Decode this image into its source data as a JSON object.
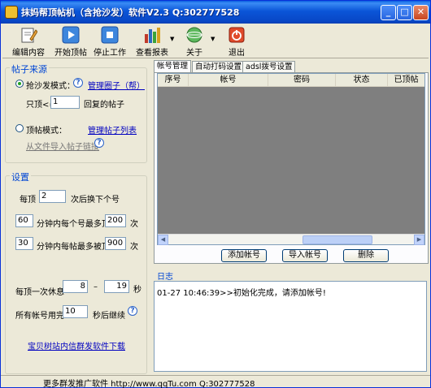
{
  "window": {
    "title": "抹妈帮顶帖机（含抢沙发）软件V2.3 Q:302777528",
    "minimize_label": "_",
    "maximize_label": "□",
    "close_label": "✕"
  },
  "toolbar": {
    "items": [
      {
        "label": "编辑内容",
        "icon": "edit-icon"
      },
      {
        "label": "开始顶帖",
        "icon": "play-icon"
      },
      {
        "label": "停止工作",
        "icon": "stop-icon"
      },
      {
        "label": "查看报表",
        "icon": "report-icon"
      },
      {
        "label": "关于",
        "icon": "about-icon"
      },
      {
        "label": "退出",
        "icon": "exit-icon"
      }
    ]
  },
  "source": {
    "title": "帖子来源",
    "grab_mode_label": "抢沙发模式：",
    "grab_mode_checked": true,
    "manage_circles_link": "管理圈子（帮）",
    "only_top_label": "只顶<=",
    "only_top_value": "1",
    "only_top_suffix": "回复的帖子",
    "top_mode_label": "顶帖模式：",
    "top_mode_checked": false,
    "manage_posts_link": "管理帖子列表",
    "import_link": "从文件导入帖子链接"
  },
  "settings": {
    "title": "设置",
    "every_label": "每顶",
    "every_value": "2",
    "every_suffix": "次后换下个号",
    "minutes1_value": "60",
    "per_account_label": "分钟内每个号最多顶",
    "per_account_value": "200",
    "times_label1": "次",
    "minutes2_value": "30",
    "per_post_label": "分钟内每帖最多被顶",
    "per_post_value": "900",
    "times_label2": "次",
    "rest_label": "每顶一次休息",
    "rest_min": "8",
    "rest_dash": "–",
    "rest_max": "19",
    "rest_unit": "秒",
    "all_used_label": "所有帐号用完",
    "all_used_value": "10",
    "all_used_suffix": "秒后继续",
    "download_link": "宝贝树站内信群发软件下载"
  },
  "tabs": [
    {
      "label": "帐号管理",
      "active": true
    },
    {
      "label": "自动打码设置",
      "active": false
    },
    {
      "label": "adsl拨号设置",
      "active": false
    }
  ],
  "table": {
    "columns": [
      "序号",
      "帐号",
      "密码",
      "状态",
      "已顶帖"
    ]
  },
  "buttons": {
    "add_account": "添加帐号",
    "import_account": "导入帐号",
    "delete": "删除"
  },
  "log": {
    "label": "日志",
    "lines": [
      "01-27 10:46:39>>初始化完成，请添加帐号!"
    ]
  },
  "status": {
    "text": "更多群发推广软件 http://www.qqTu.com Q:302777528"
  }
}
